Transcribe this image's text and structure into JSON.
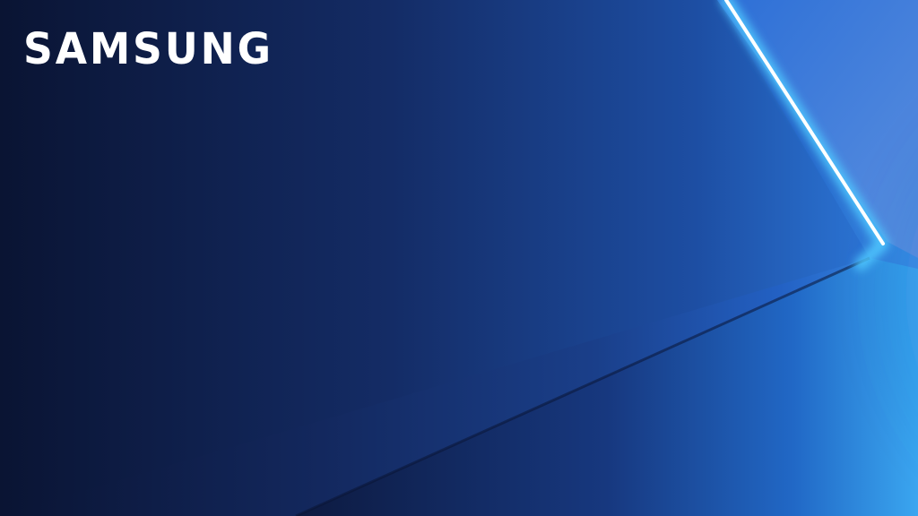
{
  "brand": {
    "name": "SAMSUNG"
  },
  "colors": {
    "background_dark": "#0a1433",
    "background_mid": "#1a3f8a",
    "glow_blue": "#3fb6ff",
    "light_streak": "#ffffff",
    "logo": "#ffffff"
  }
}
